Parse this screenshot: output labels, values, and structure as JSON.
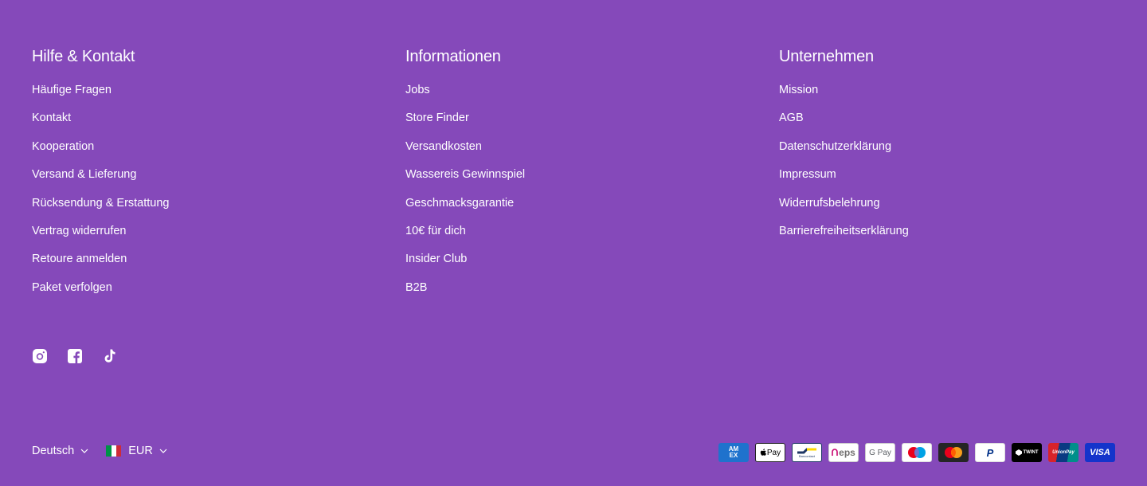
{
  "columns": [
    {
      "title": "Hilfe & Kontakt",
      "links": [
        "Häufige Fragen",
        "Kontakt",
        "Kooperation",
        "Versand & Lieferung",
        "Rücksendung & Erstattung",
        "Vertrag widerrufen",
        "Retoure anmelden",
        "Paket verfolgen"
      ]
    },
    {
      "title": "Informationen",
      "links": [
        "Jobs",
        "Store Finder",
        "Versandkosten",
        "Wassereis Gewinnspiel",
        "Geschmacksgarantie",
        "10€ für dich",
        "Insider Club",
        "B2B"
      ]
    },
    {
      "title": "Unternehmen",
      "links": [
        "Mission",
        "AGB",
        "Datenschutzerklärung",
        "Impressum",
        "Widerrufsbelehrung",
        "Barrierefreiheitserklärung"
      ]
    }
  ],
  "social": [
    "instagram-icon",
    "facebook-icon",
    "tiktok-icon"
  ],
  "locale": {
    "language": "Deutsch",
    "currency": "EUR",
    "flag_colors": [
      "#009246",
      "#ffffff",
      "#CE2B37"
    ]
  },
  "payment_methods": [
    {
      "name": "amex",
      "label": "AM EX",
      "bg": "#1F72CD"
    },
    {
      "name": "apple-pay",
      "label": "Pay",
      "bg": "#ffffff"
    },
    {
      "name": "bancontact",
      "label": "Bancontact",
      "bg": "#ffffff"
    },
    {
      "name": "eps",
      "label": "eps",
      "bg": "#ffffff"
    },
    {
      "name": "google-pay",
      "label": "G Pay",
      "bg": "#ffffff"
    },
    {
      "name": "maestro",
      "label": "",
      "bg": "#ffffff"
    },
    {
      "name": "mastercard",
      "label": "",
      "bg": "#252525"
    },
    {
      "name": "paypal",
      "label": "P",
      "bg": "#ffffff"
    },
    {
      "name": "twint",
      "label": "TWINT",
      "bg": "#000000"
    },
    {
      "name": "unionpay",
      "label": "UnionPay",
      "bg": "#D8232A"
    },
    {
      "name": "visa",
      "label": "VISA",
      "bg": "#1434CB"
    }
  ],
  "colors": {
    "background": "#8549BA",
    "text": "#ffffff"
  }
}
